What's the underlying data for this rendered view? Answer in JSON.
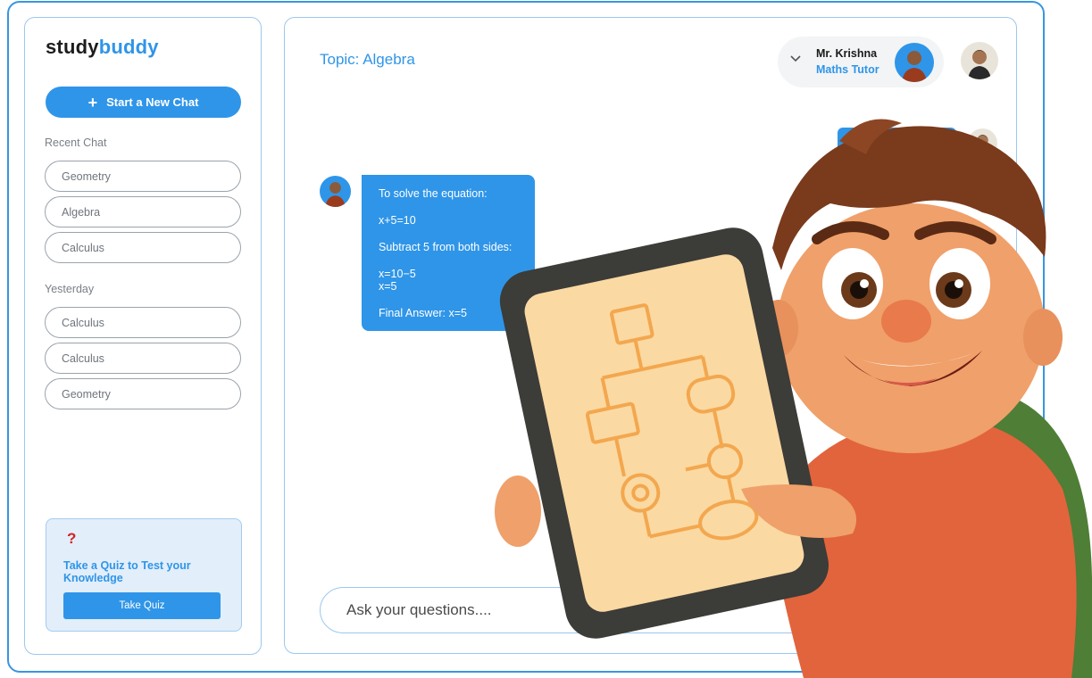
{
  "brand": {
    "part1": "study",
    "part2": "buddy"
  },
  "sidebar": {
    "new_chat_label": "Start a New Chat",
    "recent_label": "Recent Chat",
    "recent_items": [
      {
        "label": "Geometry"
      },
      {
        "label": "Algebra"
      },
      {
        "label": "Calculus"
      }
    ],
    "yesterday_label": "Yesterday",
    "yesterday_items": [
      {
        "label": "Calculus"
      },
      {
        "label": "Calculus"
      },
      {
        "label": "Geometry"
      }
    ],
    "quiz": {
      "icon_char": "?",
      "text": "Take a Quiz to Test your Knowledge",
      "button_label": "Take Quiz"
    }
  },
  "main": {
    "topic": "Topic: Algebra",
    "tutor": {
      "name": "Mr. Krishna",
      "role": "Maths Tutor"
    },
    "messages": {
      "tutor_reply": {
        "l1": "To solve the equation:",
        "l2": "x+5=10",
        "l3": "Subtract 5 from both sides:",
        "l4": "x=10−5",
        "l5": "x=5",
        "l6": "Final Answer: x=5"
      }
    },
    "input": {
      "placeholder": "Ask your questions...."
    }
  },
  "colors": {
    "accent": "#2f95e8",
    "frame": "#3a95e0",
    "quiz_bg": "#e2eefa",
    "alert": "#d61f1f"
  },
  "icons": [
    "plus-icon",
    "question-mark-icon",
    "chevron-down-icon",
    "tutor-avatar",
    "user-avatar"
  ]
}
